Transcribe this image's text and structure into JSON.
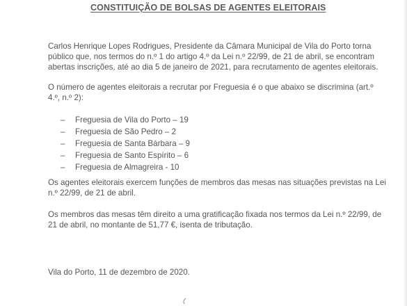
{
  "document": {
    "title": "CONSTITUIÇÃO DE BOLSAS DE AGENTES ELEITORAIS",
    "paragraph1": [
      "Carlos Henrique Lopes Rodrigues, Presidente da Câmara Municipal de Vila do Porto torna",
      "público que, nos termos do n.º 1 do artigo 4.º da Lei n.º 22/99, de 21 de abril, se encontram",
      "abertas inscrições, até ao dia 5 de janeiro de 2021, para recrutamento de agentes eleitorais."
    ],
    "paragraph2": [
      "O número de agentes eleitorais a recrutar por Freguesia é o que abaixo se discrimina (art.º",
      "4.º, n.º 2):"
    ],
    "list_marker": "–",
    "freguesias": [
      "Freguesia de Vila do Porto – 19",
      "Freguesia de São Pedro – 2",
      "Freguesia de Santa Bárbara – 9",
      "Freguesia de Santo Espírito – 6",
      "Freguesia de Almagreira - 10"
    ],
    "paragraph3": [
      "Os agentes eleitorais exercem funções de membros das mesas nas situações previstas na Lei",
      "n.º 22/99, de 21 de abril."
    ],
    "paragraph4": [
      "Os membros das mesas têm direito a uma gratificação fixada nos termos da Lei n.º 22/99, de",
      "21 de abril, no montante de 51,77 €, isenta de tributação."
    ],
    "closing": "Vila do Porto, 11 de dezembro de 2020."
  }
}
